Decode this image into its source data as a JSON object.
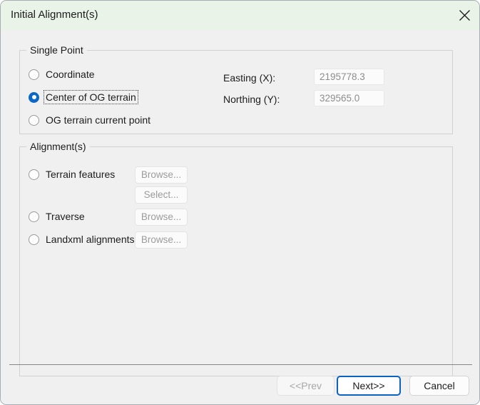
{
  "window": {
    "title": "Initial Alignment(s)",
    "close_icon": "close-icon"
  },
  "single_point": {
    "legend": "Single Point",
    "options": [
      {
        "label": "Coordinate",
        "selected": false
      },
      {
        "label": "Center of OG terrain",
        "selected": true
      },
      {
        "label": "OG terrain current point",
        "selected": false
      }
    ],
    "fields": [
      {
        "label": "Easting (X):",
        "value": "2195778.3",
        "enabled": false
      },
      {
        "label": "Northing (Y):",
        "value": "329565.0",
        "enabled": false
      }
    ]
  },
  "alignments": {
    "legend": "Alignment(s)",
    "options": [
      {
        "label": "Terrain features",
        "selected": false
      },
      {
        "label": "Traverse",
        "selected": false
      },
      {
        "label": "Landxml alignments",
        "selected": false
      }
    ],
    "buttons": {
      "browse_terrain": "Browse...",
      "select_terrain": "Select...",
      "browse_traverse": "Browse...",
      "browse_landxml": "Browse..."
    }
  },
  "footer": {
    "prev_label": "<<Prev",
    "next_label": "Next>>",
    "cancel_label": "Cancel"
  },
  "colors": {
    "titlebar": "#e9f3e8",
    "body": "#f0f0f0",
    "accent": "#0b67c8",
    "default_button_border": "#0a62c2",
    "disabled_text": "#a8a8a8"
  }
}
